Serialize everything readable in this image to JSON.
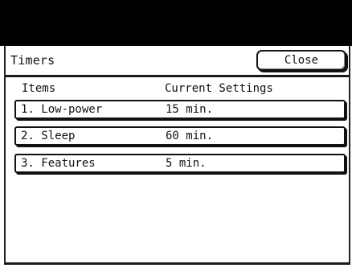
{
  "screen": {
    "title": "Timers",
    "close_label": "Close"
  },
  "columns": {
    "items": "Items",
    "current_settings": "Current Settings"
  },
  "rows": [
    {
      "label": "1. Low-power",
      "value": "15 min."
    },
    {
      "label": "2. Sleep",
      "value": "60 min."
    },
    {
      "label": "3. Features",
      "value": "5 min."
    }
  ]
}
